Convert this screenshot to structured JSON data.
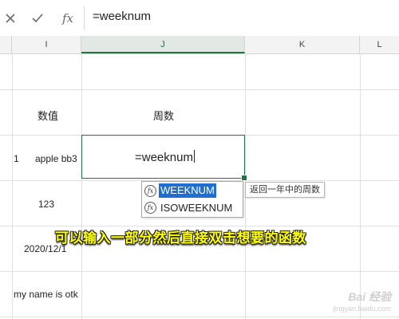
{
  "formula_bar": {
    "cancel_icon": "x-icon",
    "enter_icon": "check-icon",
    "fx_label": "fx",
    "value": "=weeknum"
  },
  "columns": [
    "I",
    "J",
    "K",
    "L"
  ],
  "selected_column": "J",
  "cells": {
    "i_header": "数值",
    "j_header": "周数",
    "row_number": "1",
    "i_row1": "apple bb3",
    "active_text": "=weeknum",
    "i_row2": "123",
    "i_row3": "2020/12/1",
    "i_row4": "my name is otk"
  },
  "autocomplete": {
    "items": [
      {
        "label": "WEEKNUM",
        "icon": "function-icon",
        "highlighted": true
      },
      {
        "label": "ISOWEEKNUM",
        "icon": "function-icon",
        "highlighted": false
      }
    ],
    "tooltip": "返回一年中的周数"
  },
  "caption": "可以输入一部分然后直接双击想要的函数",
  "watermark": {
    "logo": "Bai 经验",
    "url": "jingyan.baidu.com"
  },
  "colors": {
    "accent": "#217346",
    "highlight": "#1e6fd1",
    "caption": "#ffff00"
  }
}
